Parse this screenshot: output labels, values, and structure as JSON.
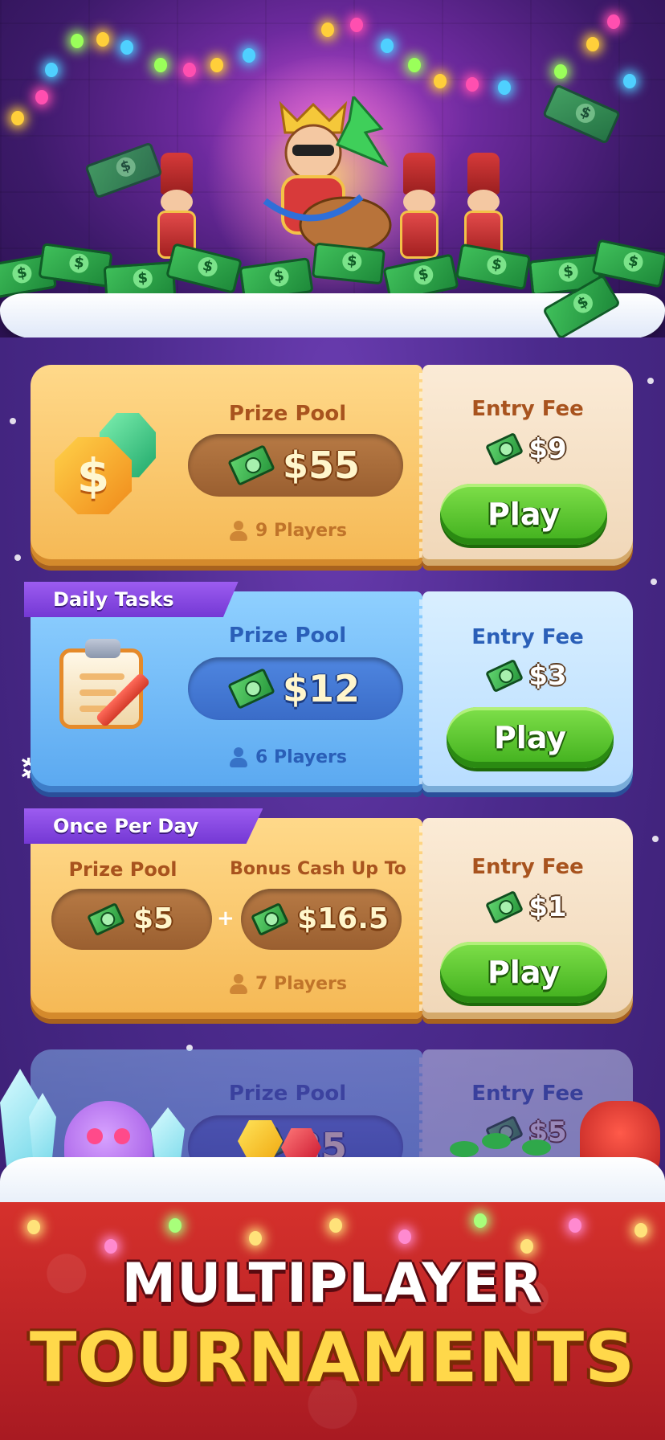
{
  "tournaments": [
    {
      "style": "gold",
      "ribbon": "",
      "prize_label": "Prize Pool",
      "prize_amount": "$55",
      "players": "9 Players",
      "fee_label": "Entry Fee",
      "fee_amount": "$9",
      "play_label": "Play",
      "emblem": "gold-coin-and-gem-icon"
    },
    {
      "style": "blue",
      "ribbon": "Daily Tasks",
      "prize_label": "Prize Pool",
      "prize_amount": "$12",
      "players": "6 Players",
      "fee_label": "Entry Fee",
      "fee_amount": "$3",
      "play_label": "Play",
      "emblem": "notepad-pencil-icon"
    },
    {
      "style": "gold",
      "ribbon": "Once Per Day",
      "prize_label": "Prize Pool",
      "prize_amount": "$5",
      "bonus_label": "Bonus Cash Up To",
      "bonus_amount": "$16.5",
      "plus": "+",
      "players": "7 Players",
      "fee_label": "Entry Fee",
      "fee_amount": "$1",
      "play_label": "Play"
    },
    {
      "style": "blue",
      "ribbon": "",
      "prize_label": "Prize Pool",
      "prize_amount": "25",
      "fee_label": "Entry Fee",
      "fee_amount": "$5"
    }
  ],
  "banner": {
    "line1": "MULTIPLAYER",
    "line2": "TOURNAMENTS"
  },
  "colors": {
    "background": "#4b2a8c",
    "gold_card": "#f5b854",
    "blue_card": "#5aa8f0",
    "play_button": "#3fae1c",
    "ribbon": "#7438d4",
    "banner_red": "#d6312c",
    "headline_yellow": "#ffd84a"
  }
}
